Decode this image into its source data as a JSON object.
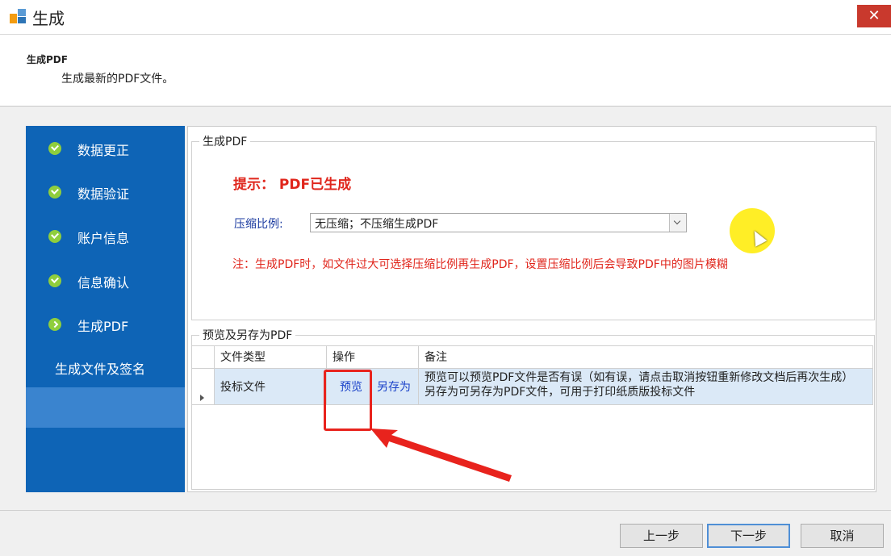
{
  "window": {
    "title": "生成",
    "close_glyph": "✕"
  },
  "header": {
    "step_title": "生成PDF",
    "step_desc": "生成最新的PDF文件。"
  },
  "sidebar": {
    "items": [
      {
        "label": "数据更正",
        "icon": "check-circle-icon"
      },
      {
        "label": "数据验证",
        "icon": "check-circle-icon"
      },
      {
        "label": "账户信息",
        "icon": "check-circle-icon"
      },
      {
        "label": "信息确认",
        "icon": "check-circle-icon"
      },
      {
        "label": "生成PDF",
        "icon": "arrow-circle-icon"
      },
      {
        "label": "生成文件及签名",
        "icon": ""
      }
    ],
    "bg_color": "#0e64b6",
    "done_color": "#8fce3d"
  },
  "generate_group": {
    "title": "生成PDF",
    "hint": "提示： PDF已生成",
    "ratio_label": "压缩比例:",
    "ratio_value": "无压缩；不压缩生成PDF",
    "note": "注：生成PDF时，如文件过大可选择压缩比例再生成PDF，设置压缩比例后会导致PDF中的图片模糊"
  },
  "preview_group": {
    "title": "预览及另存为PDF",
    "columns": [
      "文件类型",
      "操作",
      "备注"
    ],
    "rows": [
      {
        "file_type": "投标文件",
        "preview_label": "预览",
        "saveas_label": "另存为",
        "remark_1": "预览可以预览PDF文件是否有误（如有误，请点击取消按钮重新修改文档后再次生成）",
        "remark_2": "另存为可另存为PDF文件，可用于打印纸质版投标文件"
      }
    ]
  },
  "footer": {
    "prev": "上一步",
    "next": "下一步",
    "cancel": "取消"
  },
  "colors": {
    "hint_red": "#e0261c",
    "annotation_red": "#e8231d",
    "link_blue": "#1840c8"
  }
}
